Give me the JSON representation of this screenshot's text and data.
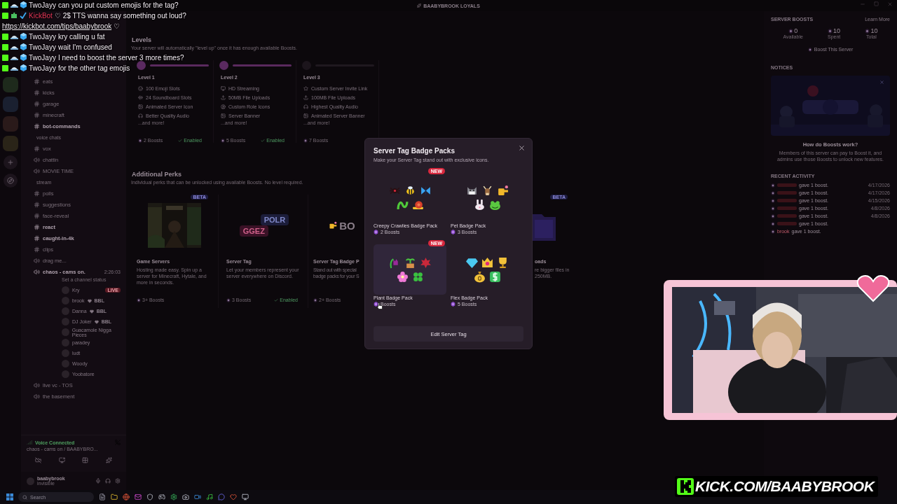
{
  "window": {
    "title": "BAABYBROOK LOYALS"
  },
  "chat": [
    {
      "kind": "user",
      "user": "TwoJayy",
      "color": "#f2e9f2",
      "message": "can you put custom emojis for the tag?"
    },
    {
      "kind": "bot",
      "user": "KickBot",
      "color": "#e8385a",
      "message": "♡ 2$ TTS wanna say something out loud?",
      "link": "https://kickbot.com/tips/baabybrook",
      "suffix": "♡"
    },
    {
      "kind": "user",
      "user": "TwoJayy",
      "color": "#f2e9f2",
      "message": "kry calling u fat"
    },
    {
      "kind": "user",
      "user": "TwoJayy",
      "color": "#f2e9f2",
      "message": "wait I'm confused"
    },
    {
      "kind": "user",
      "user": "TwoJayy",
      "color": "#f2e9f2",
      "message": "I need to boost the server 3 more times?"
    },
    {
      "kind": "user",
      "user": "TwoJayy",
      "color": "#f2e9f2",
      "message": "for the other tag emojis"
    }
  ],
  "sidebar": {
    "items": [
      {
        "kind": "text",
        "name": "eats",
        "unread": false
      },
      {
        "kind": "text",
        "name": "kicks",
        "unread": false
      },
      {
        "kind": "text",
        "name": "garage",
        "unread": false
      },
      {
        "kind": "text",
        "name": "minecraft",
        "unread": false
      },
      {
        "kind": "text",
        "name": "bot-commands",
        "unread": true
      },
      {
        "kind": "category",
        "name": "voice chats"
      },
      {
        "kind": "text",
        "name": "vox",
        "unread": false
      },
      {
        "kind": "voice",
        "name": "chattin",
        "unread": false
      },
      {
        "kind": "voice",
        "name": "MOVIE TIME",
        "unread": false
      },
      {
        "kind": "category",
        "name": "stream"
      },
      {
        "kind": "text",
        "name": "polls",
        "unread": false
      },
      {
        "kind": "text",
        "name": "suggestions",
        "unread": false
      },
      {
        "kind": "text",
        "name": "face-reveal",
        "unread": false
      },
      {
        "kind": "text",
        "name": "react",
        "unread": true
      },
      {
        "kind": "text",
        "name": "caught-in-4k",
        "unread": true
      },
      {
        "kind": "text",
        "name": "clips",
        "unread": false
      },
      {
        "kind": "voice",
        "name": "drag me...",
        "unread": false
      },
      {
        "kind": "voice",
        "name": "chaos - cams on.",
        "unread": true,
        "timer": "2:26:03",
        "status": "Set a channel status",
        "children": [
          {
            "name": "Kry",
            "badge": "LIVE"
          },
          {
            "name": "brook",
            "tag": "BBL"
          },
          {
            "name": "Danna",
            "tag": "BBL"
          },
          {
            "name": "DJ Joker",
            "tag": "BBL"
          },
          {
            "name": "Guacamole Nigga Pieces"
          },
          {
            "name": "paradey"
          },
          {
            "name": "ludt"
          },
          {
            "name": "Woody"
          },
          {
            "name": "Yoobatore"
          }
        ]
      },
      {
        "kind": "voice",
        "name": "live vc - TOS",
        "unread": false
      },
      {
        "kind": "voice",
        "name": "the basement",
        "unread": false
      }
    ],
    "voice": {
      "status": "Voice Connected",
      "channel": "chaos - cams on / BAABYBRO..."
    },
    "user": {
      "name": "baabybrook",
      "status": "invisible"
    }
  },
  "levels": {
    "title": "Levels",
    "subtitle": "Your server will automatically \"level up\" once it has enough available Boosts.",
    "items": [
      {
        "name": "Level 1",
        "reached": true,
        "perks": [
          "100 Emoji Slots",
          "24 Soundboard Slots",
          "Animated Server Icon",
          "Better Quality Audio"
        ],
        "more": "...and more!",
        "boosts": "2 Boosts",
        "status": "Enabled"
      },
      {
        "name": "Level 2",
        "reached": true,
        "perks": [
          "HD Streaming",
          "50MB File Uploads",
          "Custom Role Icons",
          "Server Banner"
        ],
        "more": "...and more!",
        "boosts": "5 Boosts",
        "status": "Enabled"
      },
      {
        "name": "Level 3",
        "reached": false,
        "perks": [
          "Custom Server Invite Link",
          "100MB File Uploads",
          "Highest Quality Audio",
          "Animated Server Banner"
        ],
        "more": "...and more!",
        "boosts": "7 Boosts"
      }
    ]
  },
  "perks": {
    "title": "Additional Perks",
    "subtitle": "Individual perks that can be unlocked using available Boosts. No level required.",
    "cards": [
      {
        "kind": "game",
        "badge": "BETA",
        "title": "Game Servers",
        "description": "Hosting made easy. Spin up a server for Minecraft, Hytale, and more in seconds.",
        "boosts": "3+ Boosts"
      },
      {
        "kind": "tag",
        "tags": [
          "POLR",
          "GGEZ"
        ],
        "title": "Server Tag",
        "description": "Let your members represent your server everywhere on Discord.",
        "boosts": "3 Boosts",
        "status": "Enabled"
      },
      {
        "kind": "badges",
        "tags": [
          "BO"
        ],
        "title": "Server Tag Badge P",
        "description": "Stand out with special badge packs for your S",
        "boosts": "2+ Boosts"
      },
      {
        "kind": "hidden"
      },
      {
        "kind": "uploads",
        "badge": "BETA",
        "title": "oads",
        "description": "re bigger files in 250MB."
      }
    ]
  },
  "boosts": {
    "title": "SERVER BOOSTS",
    "link": "Learn More",
    "stats": [
      {
        "value": "0",
        "label": "Available"
      },
      {
        "value": "10",
        "label": "Spent"
      },
      {
        "value": "10",
        "label": "Total"
      }
    ],
    "button": "Boost This Server"
  },
  "notices": {
    "title": "NOTICES",
    "heading": "How do Boosts work?",
    "text": "Members of this server can pay to Boost it, and admins use those Boosts to unlock new features."
  },
  "activity": {
    "title": "RECENT ACTIVITY",
    "rows": [
      {
        "text": "gave 1 boost.",
        "date": "4/17/2026"
      },
      {
        "text": "gave 1 boost.",
        "date": "4/17/2026"
      },
      {
        "text": "gave 1 boost.",
        "date": "4/15/2026"
      },
      {
        "text": "gave 1 boost.",
        "date": "4/8/2026"
      },
      {
        "text": "gave 1 boost.",
        "date": "4/8/2026"
      },
      {
        "text": "gave 1 boost."
      },
      {
        "name": "brook",
        "text": "gave 1 boost."
      }
    ]
  },
  "modal": {
    "title": "Server Tag Badge Packs",
    "subtitle": "Make your Server Tag stand out with exclusive icons.",
    "packs": [
      {
        "name": "Creepy Crawlies Badge Pack",
        "boosts": "2 Boosts",
        "new": "NEW",
        "hovered": false
      },
      {
        "name": "Pet Badge Pack",
        "boosts": "3 Boosts",
        "hovered": false
      },
      {
        "name": "Plant Badge Pack",
        "boosts": "Boosts",
        "new": "NEW",
        "hovered": true
      },
      {
        "name": "Flex Badge Pack",
        "boosts": "5 Boosts",
        "hovered": false
      }
    ],
    "button": "Edit Server Tag"
  },
  "taskbar": {
    "search": "Search"
  },
  "banner": {
    "text": "KICK.COM/BAABYBROOK"
  }
}
